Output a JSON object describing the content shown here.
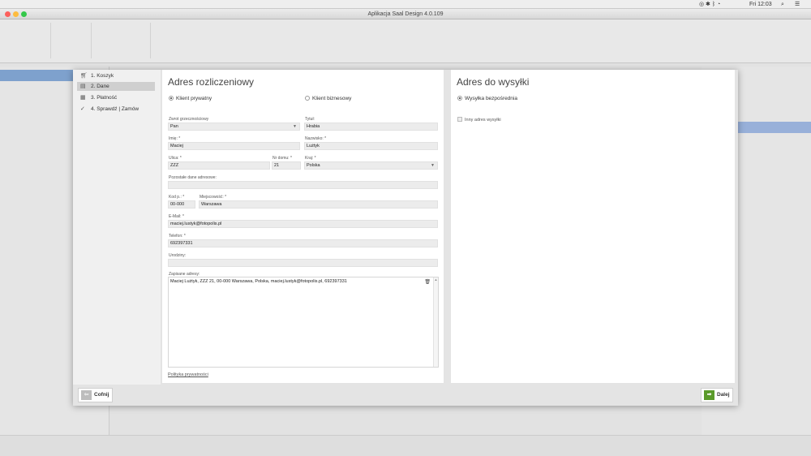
{
  "menubar": {
    "time": "Fri 12:03"
  },
  "window": {
    "title": "Aplikacja Saal Design 4.0.109",
    "colors": {
      "close": "#fc605c",
      "minimize": "#fdbc40",
      "zoom": "#34c84a"
    }
  },
  "steps": [
    {
      "label": "1. Koszyk",
      "icon": "cart-icon"
    },
    {
      "label": "2. Dane",
      "icon": "form-icon",
      "active": true
    },
    {
      "label": "3. Płatność",
      "icon": "payment-icon"
    },
    {
      "label": "4. Sprawdź | Zamów",
      "icon": "checkmark-icon"
    }
  ],
  "billing": {
    "title": "Adres rozliczeniowy",
    "customer_private": "Klient prywatny",
    "customer_business": "Klient biznesowy",
    "salutation_label": "Zwrot grzecznościowy",
    "salutation_value": "Pan",
    "title_label": "Tytuł:",
    "title_value": "Hrabia",
    "firstname_label": "Imię: *",
    "firstname_value": "Maciej",
    "lastname_label": "Nazwisko: *",
    "lastname_value": "Lużtyk",
    "street_label": "Ulica: *",
    "street_value": "ZZZ",
    "house_label": "Nr domu: *",
    "house_value": "21",
    "country_label": "Kraj: *",
    "country_value": "Polska",
    "other_label": "Pozostałe dane adresowe:",
    "other_value": "",
    "zip_label": "Kod p.: *",
    "zip_value": "00-000",
    "city_label": "Miejscowość: *",
    "city_value": "Warszawa",
    "email_label": "E-Mail: *",
    "email_value": "maciej.lustyk@fotopolis.pl",
    "phone_label": "Telefon: *",
    "phone_value": "692397331",
    "birthday_label": "Urodziny:",
    "birthday_value": "",
    "saved_label": "Zapisane adresy:",
    "saved_address": "Maciej Lużtyk, ZZZ 21, 00-000 Warszawa, Polska, maciej.lustyk@fotopolis.pl, 692397331",
    "privacy_link": "Polityka prywatności"
  },
  "shipping": {
    "title": "Adres do wysyłki",
    "direct": "Wysyłka bezpośrednia",
    "other": "Inny adres wysyłki"
  },
  "buttons": {
    "back": "Cofnij",
    "next": "Dalej",
    "next_color": "#5a9a2a",
    "back_color": "#bdbdbd"
  }
}
